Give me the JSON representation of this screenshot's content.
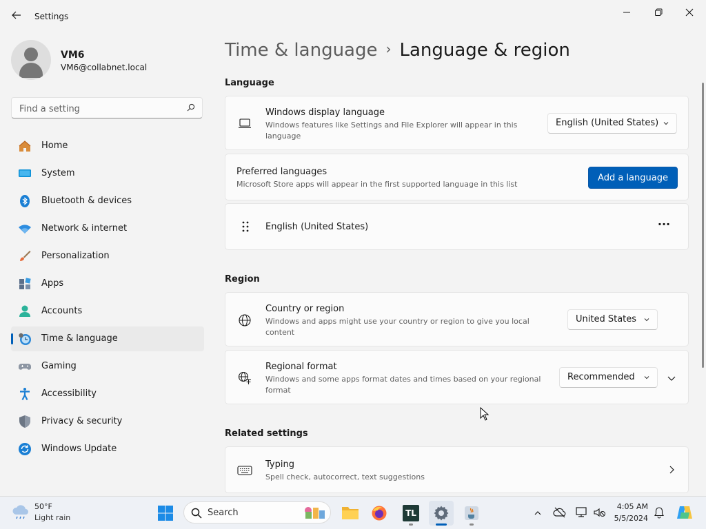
{
  "window": {
    "title": "Settings"
  },
  "user": {
    "name": "VM6",
    "email": "VM6@collabnet.local"
  },
  "search": {
    "placeholder": "Find a setting"
  },
  "nav": {
    "items": [
      {
        "label": "Home",
        "icon": "home-icon"
      },
      {
        "label": "System",
        "icon": "system-icon"
      },
      {
        "label": "Bluetooth & devices",
        "icon": "bluetooth-icon"
      },
      {
        "label": "Network & internet",
        "icon": "wifi-icon"
      },
      {
        "label": "Personalization",
        "icon": "brush-icon"
      },
      {
        "label": "Apps",
        "icon": "apps-icon"
      },
      {
        "label": "Accounts",
        "icon": "accounts-icon"
      },
      {
        "label": "Time & language",
        "icon": "clock-globe-icon",
        "active": true
      },
      {
        "label": "Gaming",
        "icon": "gamepad-icon"
      },
      {
        "label": "Accessibility",
        "icon": "accessibility-icon"
      },
      {
        "label": "Privacy & security",
        "icon": "shield-icon"
      },
      {
        "label": "Windows Update",
        "icon": "update-icon"
      }
    ]
  },
  "breadcrumb": {
    "parent": "Time & language",
    "separator": "›",
    "current": "Language & region"
  },
  "language": {
    "section_title": "Language",
    "display": {
      "title": "Windows display language",
      "desc": "Windows features like Settings and File Explorer will appear in this language",
      "value": "English (United States)"
    },
    "preferred": {
      "title": "Preferred languages",
      "desc": "Microsoft Store apps will appear in the first supported language in this list",
      "button": "Add a language"
    },
    "list": [
      {
        "label": "English (United States)",
        "more": "···"
      }
    ]
  },
  "region": {
    "section_title": "Region",
    "country": {
      "title": "Country or region",
      "desc": "Windows and apps might use your country or region to give you local content",
      "value": "United States"
    },
    "format": {
      "title": "Regional format",
      "desc": "Windows and some apps format dates and times based on your regional format",
      "value": "Recommended"
    }
  },
  "related": {
    "section_title": "Related settings",
    "typing": {
      "title": "Typing",
      "desc": "Spell check, autocorrect, text suggestions"
    }
  },
  "taskbar": {
    "weather": {
      "temp": "50°F",
      "desc": "Light rain"
    },
    "search_label": "Search",
    "tl_label": "TL",
    "clock": {
      "time": "4:05 AM",
      "date": "5/5/2024"
    }
  },
  "colors": {
    "accent": "#005fb8",
    "background": "#f3f3f3",
    "card": "#fbfbfb"
  }
}
